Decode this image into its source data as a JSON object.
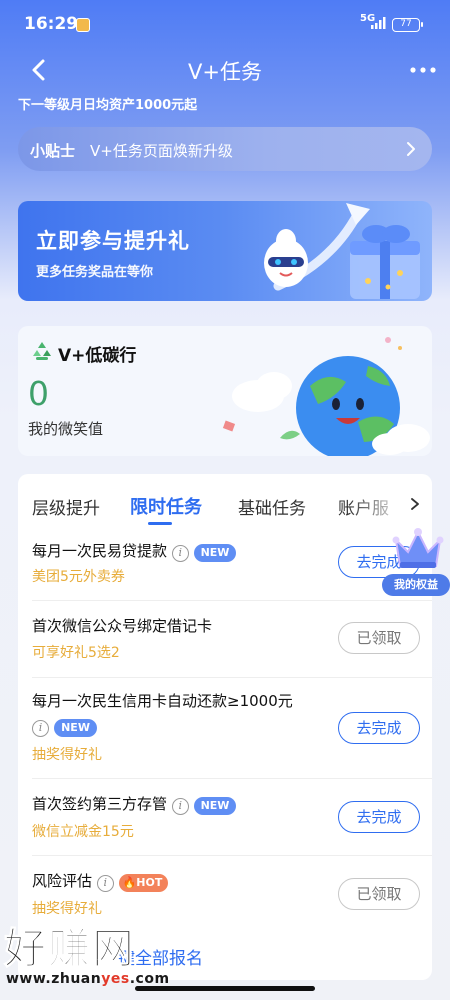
{
  "status_bar": {
    "time": "16:29",
    "network": "5G",
    "battery": "77"
  },
  "nav": {
    "title": "V+任务"
  },
  "sublabel": "下一等级月日均资产1000元起",
  "tip": {
    "label": "小贴士",
    "text": "V+任务页面焕新升级"
  },
  "promo": {
    "title": "立即参与提升礼",
    "subtitle": "更多任务奖品在等你"
  },
  "carbon": {
    "title": "V+低碳行",
    "value": "0",
    "label": "我的微笑值"
  },
  "tabs": [
    {
      "label": "层级提升"
    },
    {
      "label": "限时任务"
    },
    {
      "label": "基础任务"
    },
    {
      "label": "账户服"
    }
  ],
  "tasks": [
    {
      "name": "每月一次民易贷提款",
      "badge": "NEW",
      "reward": "美团5元外卖券",
      "button": "去完成"
    },
    {
      "name": "首次微信公众号绑定借记卡",
      "reward": "可享好礼5选2",
      "button": "已领取"
    },
    {
      "name": "每月一次民生信用卡自动还款≥1000元",
      "badge": "NEW",
      "reward": "抽奖得好礼",
      "button": "去完成"
    },
    {
      "name": "首次签约第三方存管",
      "badge": "NEW",
      "reward": "微信立减金15元",
      "button": "去完成"
    },
    {
      "name": "风险评估",
      "badge": "HOT",
      "reward": "抽奖得好礼",
      "button": "已领取"
    }
  ],
  "enroll": "键全部报名",
  "benefit_label": "我的权益",
  "watermark": {
    "big": "好赚网",
    "url_a": "www.zhuan",
    "url_b": "yes",
    "url_c": ".com"
  },
  "colors": {
    "accent": "#2f6df0",
    "reward": "#e7ac3a",
    "carbon_value": "#3ea06a",
    "new_badge": "#5f8ef4",
    "hot_badge": "#f3825a"
  }
}
